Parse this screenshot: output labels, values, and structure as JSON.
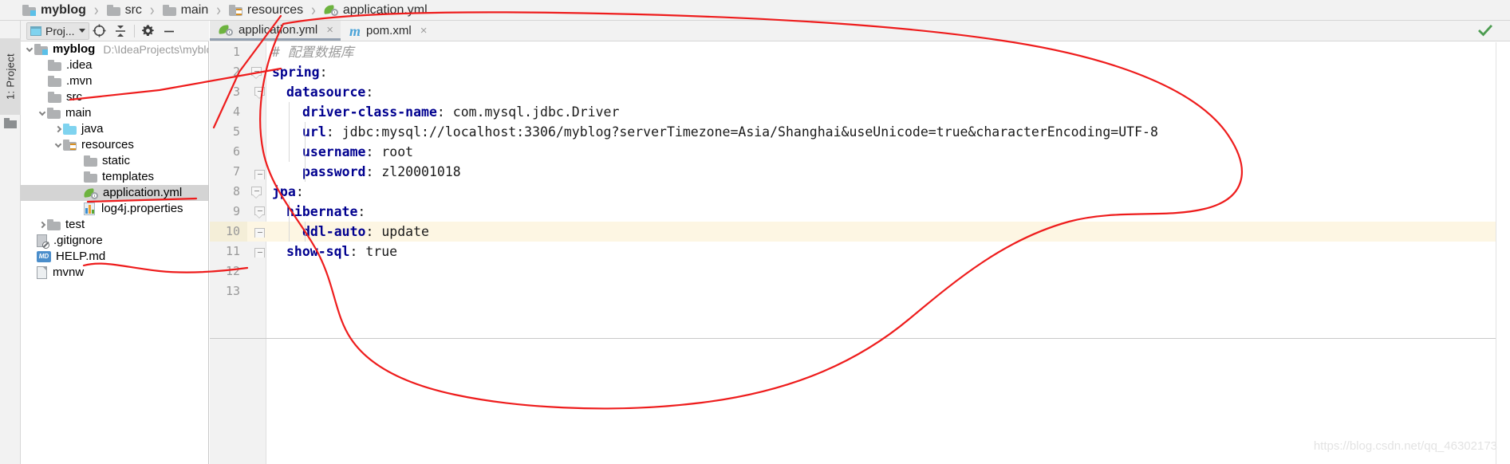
{
  "breadcrumb": {
    "items": [
      {
        "label": "myblog",
        "icon": "folder-module-icon",
        "bold": true
      },
      {
        "label": "src",
        "icon": "folder-icon",
        "bold": false
      },
      {
        "label": "main",
        "icon": "folder-icon",
        "bold": false
      },
      {
        "label": "resources",
        "icon": "folder-resources-icon",
        "bold": false
      },
      {
        "label": "application.yml",
        "icon": "spring-yml-icon",
        "bold": false
      }
    ],
    "separator": "›"
  },
  "left_rail": {
    "project_tab_label": "1: Project",
    "folder_icon": "folder-icon"
  },
  "project_panel": {
    "toolbar": {
      "selector_label": "Proj...",
      "locate_icon": "crosshair-target-icon",
      "collapse_icon": "collapse-all-icon",
      "settings_icon": "gear-icon",
      "hide_icon": "minimize-icon"
    },
    "tree": [
      {
        "label": "myblog",
        "path": "D:\\IdeaProjects\\myblo",
        "icon": "folder-module-icon",
        "indent": 0,
        "arrow": "down",
        "bold": true,
        "selected": false
      },
      {
        "label": ".idea",
        "path": "",
        "icon": "folder-icon",
        "indent": 1,
        "arrow": "none",
        "bold": false,
        "selected": false
      },
      {
        "label": ".mvn",
        "path": "",
        "icon": "folder-icon",
        "indent": 1,
        "arrow": "none",
        "bold": false,
        "selected": false
      },
      {
        "label": "src",
        "path": "",
        "icon": "folder-icon",
        "indent": 1,
        "arrow": "none",
        "bold": false,
        "selected": false
      },
      {
        "label": "main",
        "path": "",
        "icon": "folder-icon",
        "indent": 2,
        "arrow": "down",
        "bold": false,
        "selected": false
      },
      {
        "label": "java",
        "path": "",
        "icon": "folder-java-icon",
        "indent": 3,
        "arrow": "right",
        "bold": false,
        "selected": false
      },
      {
        "label": "resources",
        "path": "",
        "icon": "folder-resources-icon",
        "indent": 3,
        "arrow": "down",
        "bold": false,
        "selected": false
      },
      {
        "label": "static",
        "path": "",
        "icon": "folder-icon",
        "indent": 5,
        "arrow": "none",
        "bold": false,
        "selected": false
      },
      {
        "label": "templates",
        "path": "",
        "icon": "folder-icon",
        "indent": 5,
        "arrow": "none",
        "bold": false,
        "selected": false
      },
      {
        "label": "application.yml",
        "path": "",
        "icon": "spring-yml-icon",
        "indent": 5,
        "arrow": "none",
        "bold": false,
        "selected": true
      },
      {
        "label": "log4j.properties",
        "path": "",
        "icon": "properties-icon",
        "indent": 5,
        "arrow": "none",
        "bold": false,
        "selected": false
      },
      {
        "label": "test",
        "path": "",
        "icon": "folder-icon",
        "indent": 2,
        "arrow": "right",
        "bold": false,
        "selected": false
      },
      {
        "label": ".gitignore",
        "path": "",
        "icon": "gitignore-icon",
        "indent": 1,
        "arrow": "none",
        "bold": false,
        "selected": false
      },
      {
        "label": "HELP.md",
        "path": "",
        "icon": "markdown-icon",
        "indent": 1,
        "arrow": "none",
        "bold": false,
        "selected": false
      },
      {
        "label": "mvnw",
        "path": "",
        "icon": "file-icon",
        "indent": 1,
        "arrow": "none",
        "bold": false,
        "selected": false
      }
    ],
    "markdown_badge": "MD"
  },
  "editor": {
    "tabs": [
      {
        "label": "application.yml",
        "icon": "spring-yml-icon",
        "active": true,
        "close": "×"
      },
      {
        "label": "pom.xml",
        "icon": "maven-icon",
        "active": false,
        "close": "×"
      }
    ],
    "status_icon": "inspection-ok-check-icon",
    "highlighted_line": 10,
    "lines": [
      {
        "no": "1",
        "indent": 0,
        "type": "comment",
        "text": "# 配置数据库",
        "key": "",
        "value": ""
      },
      {
        "no": "2",
        "indent": 0,
        "type": "key",
        "key": "spring",
        "value": ""
      },
      {
        "no": "3",
        "indent": 1,
        "type": "key",
        "key": "datasource",
        "value": ""
      },
      {
        "no": "4",
        "indent": 2,
        "type": "kv",
        "key": "driver-class-name",
        "value": "com.mysql.jdbc.Driver"
      },
      {
        "no": "5",
        "indent": 2,
        "type": "kv",
        "key": "url",
        "value": "jdbc:mysql://localhost:3306/myblog?serverTimezone=Asia/Shanghai&useUnicode=true&characterEncoding=UTF-8"
      },
      {
        "no": "6",
        "indent": 2,
        "type": "kv",
        "key": "username",
        "value": "root"
      },
      {
        "no": "7",
        "indent": 2,
        "type": "kv",
        "key": "password",
        "value": "zl20001018"
      },
      {
        "no": "8",
        "indent": 0,
        "type": "key",
        "key": "jpa",
        "value": ""
      },
      {
        "no": "9",
        "indent": 1,
        "type": "key",
        "key": "hibernate",
        "value": ""
      },
      {
        "no": "10",
        "indent": 2,
        "type": "kv",
        "key": "ddl-auto",
        "value": "update"
      },
      {
        "no": "11",
        "indent": 1,
        "type": "kv",
        "key": "show-sql",
        "value": "true"
      },
      {
        "no": "12",
        "indent": 0,
        "type": "blank",
        "key": "",
        "value": ""
      },
      {
        "no": "13",
        "indent": 0,
        "type": "blank",
        "key": "",
        "value": ""
      }
    ]
  },
  "annotation": {
    "color": "#ee1c1c",
    "description": "hand-drawn red lasso circling the editor and arrows pointing at src, application.yml and test"
  },
  "watermark": {
    "text": "https://blog.csdn.net/qq_46302173"
  },
  "colors": {
    "key": "#00008f",
    "value": "#1a1a1a",
    "comment": "#9a9a9a",
    "selection": "#d4d4d4",
    "highlight_line": "#fdf6e3",
    "spring_green": "#6db33f",
    "accent_ok": "#4c9c50"
  }
}
